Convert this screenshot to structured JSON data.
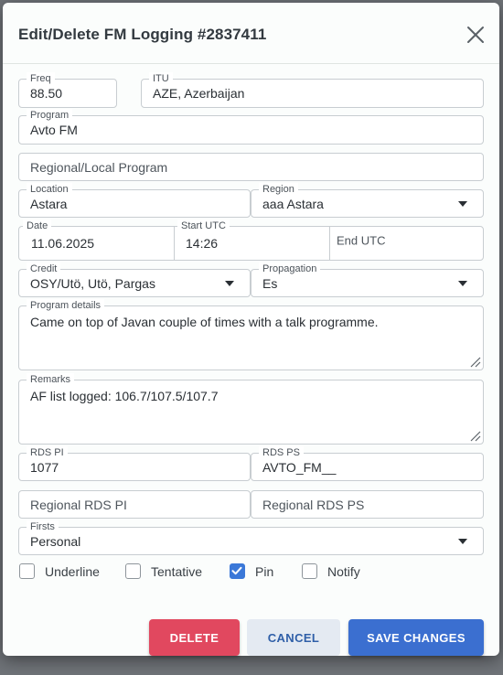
{
  "dialog": {
    "title": "Edit/Delete FM Logging #2837411"
  },
  "fields": {
    "freq": {
      "label": "Freq",
      "value": "88.50"
    },
    "itu": {
      "label": "ITU",
      "value": "AZE, Azerbaijan"
    },
    "program": {
      "label": "Program",
      "value": "Avto FM"
    },
    "regional_program": {
      "placeholder": "Regional/Local Program"
    },
    "location": {
      "label": "Location",
      "value": "Astara"
    },
    "region": {
      "label": "Region",
      "value": "aaa Astara"
    },
    "date": {
      "label": "Date",
      "value": "11.06.2025"
    },
    "start_utc": {
      "label": "Start UTC",
      "value": "14:26"
    },
    "end_utc": {
      "placeholder": "End UTC"
    },
    "credit": {
      "label": "Credit",
      "value": "OSY/Utö, Utö, Pargas"
    },
    "propagation": {
      "label": "Propagation",
      "value": "Es"
    },
    "program_details": {
      "label": "Program details",
      "value": "Came on top of Javan couple of times with a talk programme."
    },
    "remarks": {
      "label": "Remarks",
      "value": "AF list logged: 106.7/107.5/107.7"
    },
    "rds_pi": {
      "label": "RDS PI",
      "value": "1077"
    },
    "rds_ps": {
      "label": "RDS PS",
      "value": "AVTO_FM__"
    },
    "regional_rds_pi": {
      "placeholder": "Regional RDS PI"
    },
    "regional_rds_ps": {
      "placeholder": "Regional RDS PS"
    },
    "firsts": {
      "label": "Firsts",
      "value": "Personal"
    }
  },
  "checkboxes": [
    {
      "label": "Underline",
      "checked": false
    },
    {
      "label": "Tentative",
      "checked": false
    },
    {
      "label": "Pin",
      "checked": true
    },
    {
      "label": "Notify",
      "checked": false
    }
  ],
  "buttons": {
    "delete": "DELETE",
    "cancel": "CANCEL",
    "save": "SAVE CHANGES"
  },
  "colors": {
    "delete": "#e1485f",
    "save": "#3b6fd0",
    "cancel_text": "#2f5fa8",
    "checkbox_checked": "#3b78d8"
  },
  "icons": {
    "close": "close-icon",
    "dropdown": "chevron-down-icon",
    "resize": "resize-grip-icon",
    "check": "check-icon"
  }
}
